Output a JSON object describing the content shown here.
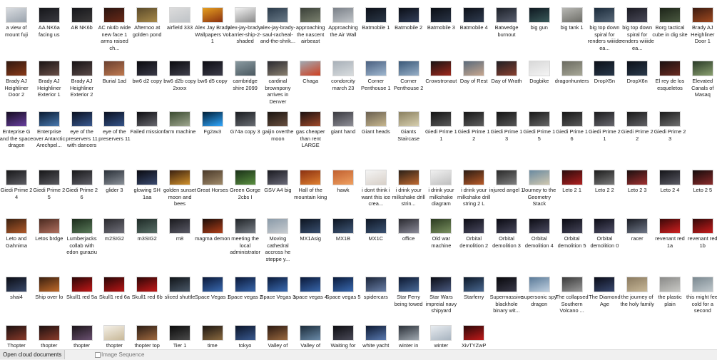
{
  "statusbar": {
    "left_label": "Open cloud documents",
    "seq_label": "Image Sequence"
  },
  "rows": [
    [
      {
        "label": "a view of mount fuji",
        "c1": "#d9dce0",
        "c2": "#9aa3ad"
      },
      {
        "label": "AA NK6a facing us",
        "c1": "#15161a",
        "c2": "#3a3a40"
      },
      {
        "label": "AB NK6b",
        "c1": "#15161a",
        "c2": "#3c3a3a"
      },
      {
        "label": "AC nk4b wide new face 1 arms raised ch...",
        "c1": "#2a1410",
        "c2": "#6a2a18"
      },
      {
        "label": "Afternoo at golden pond",
        "c1": "#5a4a2a",
        "c2": "#a88a4a"
      },
      {
        "label": "airfield 333",
        "c1": "#dcdcdc",
        "c2": "#bfc3c7"
      },
      {
        "label": "Alex Jay Brady Wallpapers Vol 1",
        "c1": "#e6a020",
        "c2": "#8a3010"
      },
      {
        "label": "alex-jay-brady-carrier-ship-2-shaded",
        "c1": "#f2f2f2",
        "c2": "#8a8a8a"
      },
      {
        "label": "alex-jay-brady-saul-racheal-and-the-shrik...",
        "c1": "#2a3a4a",
        "c2": "#6a7a88"
      },
      {
        "label": "approaching the nascent airbeast",
        "c1": "#3a4038",
        "c2": "#7a806e"
      },
      {
        "label": "Approaching the Air Wall",
        "c1": "#7a8088",
        "c2": "#c0c4c8"
      },
      {
        "label": "Batmobile 1",
        "c1": "#0c1018",
        "c2": "#2c3848"
      },
      {
        "label": "Batmobile 2",
        "c1": "#0a0e16",
        "c2": "#34405a"
      },
      {
        "label": "Batmobile 3",
        "c1": "#0a0e14",
        "c2": "#2a3446"
      },
      {
        "label": "Batmobile 4",
        "c1": "#0c1018",
        "c2": "#303c50"
      },
      {
        "label": "Batwedge burnout",
        "c1": "#1c2028",
        "c2": "#5a6070"
      },
      {
        "label": "big gun",
        "c1": "#0e1820",
        "c2": "#3a5a5a"
      },
      {
        "label": "big tank 1",
        "c1": "#b8b8b4",
        "c2": "#6e6e68"
      },
      {
        "label": "big top down spiral for renders wiiiide ea...",
        "c1": "#1a2a3a",
        "c2": "#5a6a7a"
      },
      {
        "label": "big top down spiral for renders wiiiide ea...",
        "c1": "#1a1a22",
        "c2": "#4a4a58"
      },
      {
        "label": "Borg tactical cube in dig site",
        "c1": "#1c2418",
        "c2": "#4a5840"
      },
      {
        "label": "Brady AJ Heighliner Door 1",
        "c1": "#3a1a10",
        "c2": "#a04a20"
      }
    ],
    [
      {
        "label": "Brady AJ Heighliner Door 2",
        "c1": "#301810",
        "c2": "#8a3a18"
      },
      {
        "label": "Brady AJ Heighliner Exterior 1",
        "c1": "#1a1414",
        "c2": "#6a5048"
      },
      {
        "label": "Brady AJ Heighliner Exterior 2",
        "c1": "#161214",
        "c2": "#5a4a48"
      },
      {
        "label": "Burial 1ad",
        "c1": "#6a4030",
        "c2": "#c07a50"
      },
      {
        "label": "bw6 d2 copy",
        "c1": "#0a0a0e",
        "c2": "#3a3a48"
      },
      {
        "label": "bw6 d2b copy 2xxxx",
        "c1": "#0a0a0e",
        "c2": "#40404c"
      },
      {
        "label": "bw6 d5 copy",
        "c1": "#0c0c12",
        "c2": "#3c3c4a"
      },
      {
        "label": "cambridge shire 2099",
        "c1": "#8a9aa0",
        "c2": "#4a5860"
      },
      {
        "label": "cardinal brownpony arrives in Denver",
        "c1": "#2a2a30",
        "c2": "#8a8070"
      },
      {
        "label": "Chaga",
        "c1": "#a0a8b0",
        "c2": "#d04020"
      },
      {
        "label": "condorcity march 23",
        "c1": "#a8b0b8",
        "c2": "#d8dcde"
      },
      {
        "label": "Corner Penthouse 1",
        "c1": "#4a6080",
        "c2": "#a0b8d0"
      },
      {
        "label": "Corner Penthouse 2",
        "c1": "#3a5878",
        "c2": "#98b0c8"
      },
      {
        "label": "Crowstronaut",
        "c1": "#181414",
        "c2": "#a0281c"
      },
      {
        "label": "Day of Rest",
        "c1": "#5a6a7a",
        "c2": "#c8a890"
      },
      {
        "label": "Day of Wrath",
        "c1": "#202024",
        "c2": "#8a4030"
      },
      {
        "label": "Dogbike",
        "c1": "#d8d8d8",
        "c2": "#f4f4f4"
      },
      {
        "label": "dragonhunters",
        "c1": "#6a6a60",
        "c2": "#a8a898"
      },
      {
        "label": "DropX5n",
        "c1": "#0c1018",
        "c2": "#28384a"
      },
      {
        "label": "DropX6n",
        "c1": "#0c1018",
        "c2": "#2a3a4c"
      },
      {
        "label": "El rey de los esqueletos",
        "c1": "#1a1010",
        "c2": "#6a2a20"
      },
      {
        "label": "Elevated Canals of Masaq",
        "c1": "#2a3a28",
        "c2": "#8aa070"
      }
    ],
    [
      {
        "label": "Enteprise G and the space dragon",
        "c1": "#140c20",
        "c2": "#6a40a0"
      },
      {
        "label": "Enterprise over Antarctic Arechpel...",
        "c1": "#0a1a30",
        "c2": "#4a7ab0"
      },
      {
        "label": "eye of the preservers 11 with dancers",
        "c1": "#0a1020",
        "c2": "#3a5a90"
      },
      {
        "label": "eye of the preservers 11",
        "c1": "#0a1020",
        "c2": "#36558a"
      },
      {
        "label": "Failed mission",
        "c1": "#0c0c10",
        "c2": "#6a6a70"
      },
      {
        "label": "farm machine",
        "c1": "#3a4a30",
        "c2": "#a0a890"
      },
      {
        "label": "Fg2av3",
        "c1": "#001e36",
        "c2": "#31a8ff"
      },
      {
        "label": "G74a copy 3",
        "c1": "#1a1c20",
        "c2": "#6a6e74"
      },
      {
        "label": "gaijin overthe moon",
        "c1": "#1a1410",
        "c2": "#6a5040"
      },
      {
        "label": "gas cheaper than rent LARGE",
        "c1": "#1a1010",
        "c2": "#a04a2a"
      },
      {
        "label": "giant hand",
        "c1": "#3a3a40",
        "c2": "#909098"
      },
      {
        "label": "Giant heads",
        "c1": "#6a6050",
        "c2": "#c8b890"
      },
      {
        "label": "Giants Staircase",
        "c1": "#8a8060",
        "c2": "#d8d0b0"
      },
      {
        "label": "Giedi Prime 1 1",
        "c1": "#141414",
        "c2": "#5a5a5a"
      },
      {
        "label": "Giedi Prime 1 2",
        "c1": "#161616",
        "c2": "#606060"
      },
      {
        "label": "Giedi Prime 1 3",
        "c1": "#141414",
        "c2": "#585858"
      },
      {
        "label": "Giedi Prime 1 5",
        "c1": "#181818",
        "c2": "#686868"
      },
      {
        "label": "Giedi Prime 1 6",
        "c1": "#151515",
        "c2": "#5c5c5c"
      },
      {
        "label": "Giedi Prime 2 1",
        "c1": "#1a1a1c",
        "c2": "#6a6a70"
      },
      {
        "label": "Giedi Prime 2 2",
        "c1": "#181818",
        "c2": "#646468"
      },
      {
        "label": "Giedi Prime 2 3",
        "c1": "#1a1a1a",
        "c2": "#707070"
      }
    ],
    [
      {
        "label": "Giedi Prime 2 4",
        "c1": "#18181a",
        "c2": "#5e5e64"
      },
      {
        "label": "Giedi Prime 2 5",
        "c1": "#161618",
        "c2": "#5a5a60"
      },
      {
        "label": "Giedi Prime 2 6",
        "c1": "#18181a",
        "c2": "#606068"
      },
      {
        "label": "glider 3",
        "c1": "#2a3038",
        "c2": "#8a9098"
      },
      {
        "label": "glowing SH 1aa",
        "c1": "#0a0a10",
        "c2": "#3a4a70"
      },
      {
        "label": "golden sunset moon and bees",
        "c1": "#3a2010",
        "c2": "#d0902a"
      },
      {
        "label": "Great Horses",
        "c1": "#4a3a2a",
        "c2": "#a08a6a"
      },
      {
        "label": "Green Gorge 2cbs I",
        "c1": "#1a3018",
        "c2": "#5a9040"
      },
      {
        "label": "GSV A4 big",
        "c1": "#1a1a20",
        "c2": "#6a6a78"
      },
      {
        "label": "Hall of the mountain king",
        "c1": "#8a3010",
        "c2": "#e08030"
      },
      {
        "label": "hawk",
        "c1": "#c06030",
        "c2": "#f0a060"
      },
      {
        "label": "i dont think i want this ice crea...",
        "c1": "#f4f4f4",
        "c2": "#d8d0c8"
      },
      {
        "label": "i drink your milkshake drill strin...",
        "c1": "#2a2018",
        "c2": "#c06a30"
      },
      {
        "label": "i drink your milkshake diagram",
        "c1": "#f0f0f0",
        "c2": "#c0c0c0"
      },
      {
        "label": "i drink your milkshake drill string 2 L",
        "c1": "#2a1c14",
        "c2": "#b85a28"
      },
      {
        "label": "injured angel 1",
        "c1": "#2a2a2a",
        "c2": "#808080"
      },
      {
        "label": "Journey to the Geometry Stack",
        "c1": "#6a8aa0",
        "c2": "#d0c8b0"
      },
      {
        "label": "Leto 2 1",
        "c1": "#2a0c0c",
        "c2": "#b02020"
      },
      {
        "label": "Leto 2 2",
        "c1": "#1c1c1c",
        "c2": "#7a7a7a"
      },
      {
        "label": "Leto 2 3",
        "c1": "#1a1010",
        "c2": "#a03030"
      },
      {
        "label": "Leto 2 4",
        "c1": "#141418",
        "c2": "#5a5a64"
      },
      {
        "label": "Leto 2 5",
        "c1": "#140c0c",
        "c2": "#8a2a2a"
      }
    ],
    [
      {
        "label": "Leto and Gahnima",
        "c1": "#3a2010",
        "c2": "#b05a2a"
      },
      {
        "label": "Letos brdge",
        "c1": "#4a2a20",
        "c2": "#b07060"
      },
      {
        "label": "Lumberjacks collab with edon guraziu",
        "c1": "#1a2a1a",
        "c2": "#5a7a5a"
      },
      {
        "label": "m2SIG2",
        "c1": "#2a2a2e",
        "c2": "#70707a"
      },
      {
        "label": "m3SIG2",
        "c1": "#1e2a26",
        "c2": "#5a7068"
      },
      {
        "label": "m8",
        "c1": "#1a1a1e",
        "c2": "#5a5a66"
      },
      {
        "label": "magma demon",
        "c1": "#1a0c08",
        "c2": "#b0401a"
      },
      {
        "label": "meeting the local administrator",
        "c1": "#202428",
        "c2": "#7a8088"
      },
      {
        "label": "Moving cathedral accross he steppe y...",
        "c1": "#8a9aa8",
        "c2": "#c8ccd0"
      },
      {
        "label": "MX1Asig",
        "c1": "#0c1420",
        "c2": "#3a5070"
      },
      {
        "label": "MX1B",
        "c1": "#0c1420",
        "c2": "#405878"
      },
      {
        "label": "MX1C",
        "c1": "#0e1624",
        "c2": "#3c5474"
      },
      {
        "label": "office",
        "c1": "#2a2a30",
        "c2": "#8a8a98"
      },
      {
        "label": "Old war machine",
        "c1": "#2a3a20",
        "c2": "#7a9060"
      },
      {
        "label": "Orbital demolition 2",
        "c1": "#0c0c14",
        "c2": "#4a4a60"
      },
      {
        "label": "Orbital demolition 3",
        "c1": "#0a0a12",
        "c2": "#48485c"
      },
      {
        "label": "Orbital demolition 4",
        "c1": "#0c0c14",
        "c2": "#4c4c62"
      },
      {
        "label": "Orbital demolition 5",
        "c1": "#0a0a12",
        "c2": "#46465a"
      },
      {
        "label": "Orbital demolition 0",
        "c1": "#0c0c16",
        "c2": "#505068"
      },
      {
        "label": "racer",
        "c1": "#1a1c24",
        "c2": "#707888"
      },
      {
        "label": "revenant red 1a",
        "c1": "#3a0808",
        "c2": "#d02020"
      },
      {
        "label": "revenant red 1b",
        "c1": "#300808",
        "c2": "#c81c1c"
      }
    ],
    [
      {
        "label": "shai4",
        "c1": "#0a0c14",
        "c2": "#3a4a6a"
      },
      {
        "label": "Ship over lo",
        "c1": "#3a2010",
        "c2": "#c06a2a"
      },
      {
        "label": "Skull1 red 5a",
        "c1": "#2a0606",
        "c2": "#c01818"
      },
      {
        "label": "Skull1 red 6a",
        "c1": "#280606",
        "c2": "#b81616"
      },
      {
        "label": "Skull1 red 6b",
        "c1": "#2c0606",
        "c2": "#c41a1a"
      },
      {
        "label": "sliced shuttle",
        "c1": "#101418",
        "c2": "#4a5868"
      },
      {
        "label": "Space Vegas 1",
        "c1": "#0a1838",
        "c2": "#3a6ab0"
      },
      {
        "label": "Space vegas 2",
        "c1": "#0a1838",
        "c2": "#3a68ac"
      },
      {
        "label": "Space Vegas 3",
        "c1": "#0a1a3a",
        "c2": "#3c6cb2"
      },
      {
        "label": "space vegas 4",
        "c1": "#0a1838",
        "c2": "#3866aa"
      },
      {
        "label": "Space vegas 5",
        "c1": "#0a1a3a",
        "c2": "#3a6ab0"
      },
      {
        "label": "spidercars",
        "c1": "#1a2438",
        "c2": "#6a80a8"
      },
      {
        "label": "Star Ferry being towed",
        "c1": "#0c1830",
        "c2": "#4a6a98"
      },
      {
        "label": "Star Wars impreial navy shipyard",
        "c1": "#0a0c14",
        "c2": "#4a5a80"
      },
      {
        "label": "Starferry",
        "c1": "#0c1828",
        "c2": "#4a6890"
      },
      {
        "label": "Supermassive blackhole binary wit...",
        "c1": "#08080c",
        "c2": "#3a3a4a"
      },
      {
        "label": "supersonic spy dragon",
        "c1": "#5a7a98",
        "c2": "#c0d0e0"
      },
      {
        "label": "The collapsed Southern Volcano ...",
        "c1": "#3a3a3a",
        "c2": "#9a9a9a"
      },
      {
        "label": "The Diamond Age",
        "c1": "#0a0c18",
        "c2": "#3a4a70"
      },
      {
        "label": "the journey of the holy family",
        "c1": "#8a7a60",
        "c2": "#c8b898"
      },
      {
        "label": "the plastic plain",
        "c1": "#8a8a88",
        "c2": "#c8c8c4"
      },
      {
        "label": "this might feel cold for a second",
        "c1": "#7a8890",
        "c2": "#c0c8cc"
      }
    ],
    [
      {
        "label": "Thopter",
        "c1": "#1a1010",
        "c2": "#8a3a2a"
      },
      {
        "label": "thopter",
        "c1": "#1c1010",
        "c2": "#8a3c2a"
      },
      {
        "label": "thopter",
        "c1": "#1a1418",
        "c2": "#6a5070"
      },
      {
        "label": "thopter",
        "c1": "#f4f0e8",
        "c2": "#c8b898"
      },
      {
        "label": "thopter top",
        "c1": "#2a1c14",
        "c2": "#a06a40"
      },
      {
        "label": "Tier 1",
        "c1": "#0a0a0a",
        "c2": "#4a4a4a"
      },
      {
        "label": "time",
        "c1": "#1a1410",
        "c2": "#8a6a40"
      },
      {
        "label": "tokyo",
        "c1": "#0a1428",
        "c2": "#3a5a90"
      },
      {
        "label": "Valley of",
        "c1": "#2a1810",
        "c2": "#9a6a40"
      },
      {
        "label": "Valley of",
        "c1": "#1a2a38",
        "c2": "#6a8aa8"
      },
      {
        "label": "Waiting for",
        "c1": "#0c0c10",
        "c2": "#4a4a58"
      },
      {
        "label": "white yacht",
        "c1": "#0c1830",
        "c2": "#5a7ab0"
      },
      {
        "label": "winter in",
        "c1": "#2a3038",
        "c2": "#a0a8b0"
      },
      {
        "label": "winter",
        "c1": "#e8ecf0",
        "c2": "#a8b4c0"
      },
      {
        "label": "XivTYZwP",
        "c1": "#2a0808",
        "c2": "#c01a1a"
      }
    ]
  ]
}
